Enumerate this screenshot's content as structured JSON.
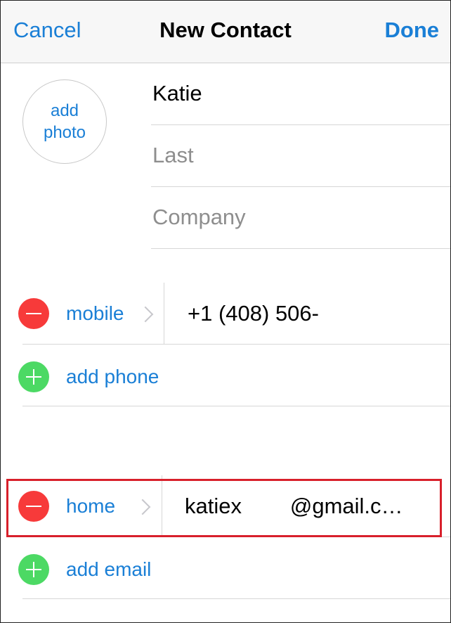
{
  "nav": {
    "cancel_label": "Cancel",
    "title": "New Contact",
    "done_label": "Done"
  },
  "photo": {
    "line1": "add",
    "line2": "photo"
  },
  "name_fields": {
    "first_value": "Katie",
    "last_placeholder": "Last",
    "company_placeholder": "Company"
  },
  "phone": {
    "label": "mobile",
    "value": "+1 (408) 506-",
    "add_label": "add phone"
  },
  "email": {
    "label": "home",
    "value": "katiex        @gmail.c…",
    "add_label": "add email"
  },
  "colors": {
    "accent": "#1a7fd6",
    "delete": "#f73a3a",
    "add": "#4cd964",
    "highlight": "#d8202b"
  }
}
